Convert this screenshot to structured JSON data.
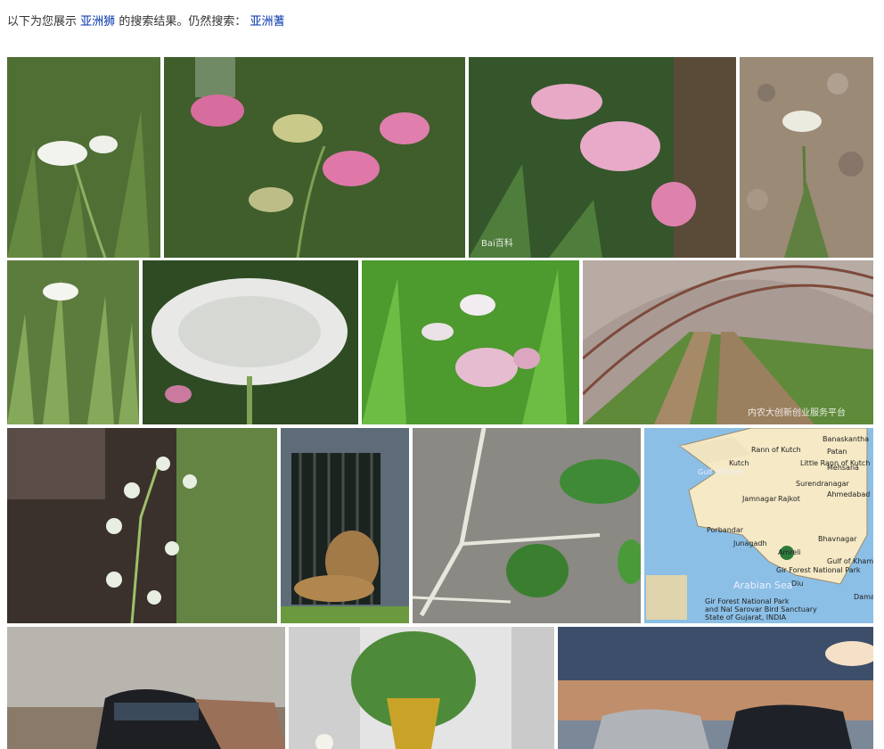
{
  "notice": {
    "prefix": "以下为您展示",
    "query": "亚洲狮",
    "middle": "的搜索结果。仍然搜索：",
    "original_query": "亚洲蓍"
  },
  "images": [
    {
      "name": "yarrow-white-flower"
    },
    {
      "name": "yarrow-pink-flower"
    },
    {
      "name": "yarrow-pink-bush",
      "watermark": "Bai百科"
    },
    {
      "name": "yarrow-rocky-soil"
    },
    {
      "name": "yarrow-grass-white"
    },
    {
      "name": "yarrow-white-closeup"
    },
    {
      "name": "yarrow-white-pink-green"
    },
    {
      "name": "greenhouse-field",
      "watermark": "内农大创新创业服务平台"
    },
    {
      "name": "white-star-flower"
    },
    {
      "name": "asiatic-lion-cage"
    },
    {
      "name": "white-root-vine"
    },
    {
      "name": "gir-forest-map",
      "map_labels": [
        "Gulf of Kutch",
        "Arabian Sea",
        "Gulf of Khambhat",
        "Gir Forest National Park",
        "Jamnagar",
        "Rajkot",
        "Porbandar",
        "Junagadh",
        "Bhavnagar",
        "Surendranagar",
        "Kutch",
        "Little Rann of Kutch",
        "Rann of Kutch",
        "Banaskantha",
        "Patan",
        "Mehsana",
        "Ahmedabad",
        "Diu",
        "Amreli",
        "Daman"
      ],
      "map_caption": [
        "Gir Forest National Park",
        "and Nal Sarovar Bird Sanctuary",
        "State of Gujarat, INDIA"
      ]
    },
    {
      "name": "toyota-car-park"
    },
    {
      "name": "fern-in-pot"
    },
    {
      "name": "toyota-cars-sunset"
    }
  ]
}
